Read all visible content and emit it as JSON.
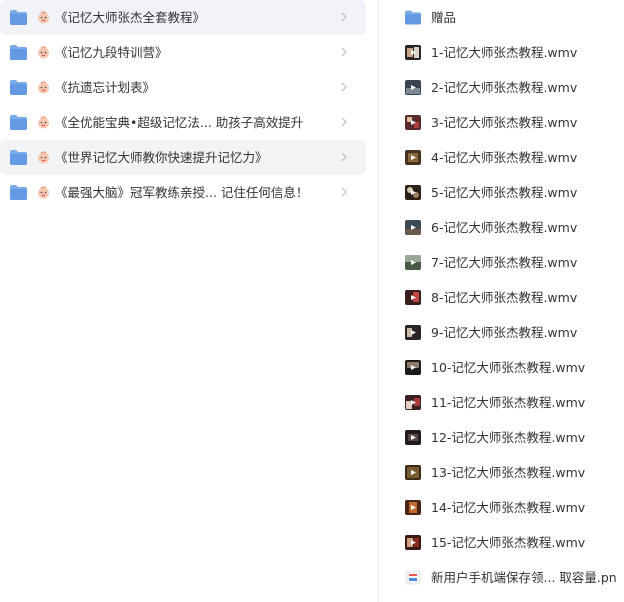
{
  "folders": [
    {
      "label": "《记忆大师张杰全套教程》",
      "icon": "folder-icon",
      "state": "active"
    },
    {
      "label": "《记忆九段特训营》",
      "icon": "folder-icon",
      "state": ""
    },
    {
      "label": "《抗遗忘计划表》",
      "icon": "folder-icon",
      "state": ""
    },
    {
      "label": "《全优能宝典•超级记忆法... 助孩子高效提升",
      "icon": "folder-icon",
      "state": ""
    },
    {
      "label": "《世界记忆大师教你快速提升记忆力》",
      "icon": "folder-icon",
      "state": "hover"
    },
    {
      "label": "《最强大脑》冠军教练亲授... 记住任何信息！",
      "icon": "folder-icon",
      "state": ""
    }
  ],
  "files": [
    {
      "label": "赠品",
      "icon": "folder-icon"
    },
    {
      "label": "1-记忆大师张杰教程.wmv",
      "icon": "video-thumbnail-icon"
    },
    {
      "label": "2-记忆大师张杰教程.wmv",
      "icon": "video-thumbnail-icon"
    },
    {
      "label": "3-记忆大师张杰教程.wmv",
      "icon": "video-thumbnail-icon"
    },
    {
      "label": "4-记忆大师张杰教程.wmv",
      "icon": "video-thumbnail-icon"
    },
    {
      "label": "5-记忆大师张杰教程.wmv",
      "icon": "video-thumbnail-icon"
    },
    {
      "label": "6-记忆大师张杰教程.wmv",
      "icon": "video-thumbnail-icon"
    },
    {
      "label": "7-记忆大师张杰教程.wmv",
      "icon": "video-thumbnail-icon"
    },
    {
      "label": "8-记忆大师张杰教程.wmv",
      "icon": "video-thumbnail-icon"
    },
    {
      "label": "9-记忆大师张杰教程.wmv",
      "icon": "video-thumbnail-icon"
    },
    {
      "label": "10-记忆大师张杰教程.wmv",
      "icon": "video-thumbnail-icon"
    },
    {
      "label": "11-记忆大师张杰教程.wmv",
      "icon": "video-thumbnail-icon"
    },
    {
      "label": "12-记忆大师张杰教程.wmv",
      "icon": "video-thumbnail-icon"
    },
    {
      "label": "13-记忆大师张杰教程.wmv",
      "icon": "video-thumbnail-icon"
    },
    {
      "label": "14-记忆大师张杰教程.wmv",
      "icon": "video-thumbnail-icon"
    },
    {
      "label": "15-记忆大师张杰教程.wmv",
      "icon": "video-thumbnail-icon"
    },
    {
      "label": "新用户手机端保存领... 取容量.pn",
      "icon": "image-file-icon"
    }
  ],
  "colors": {
    "folder": "#6fa3e8",
    "folder_tab": "#5a90dd",
    "active_row": "#f1f3f8",
    "text": "#333333",
    "chevron": "#b8bcc4"
  }
}
